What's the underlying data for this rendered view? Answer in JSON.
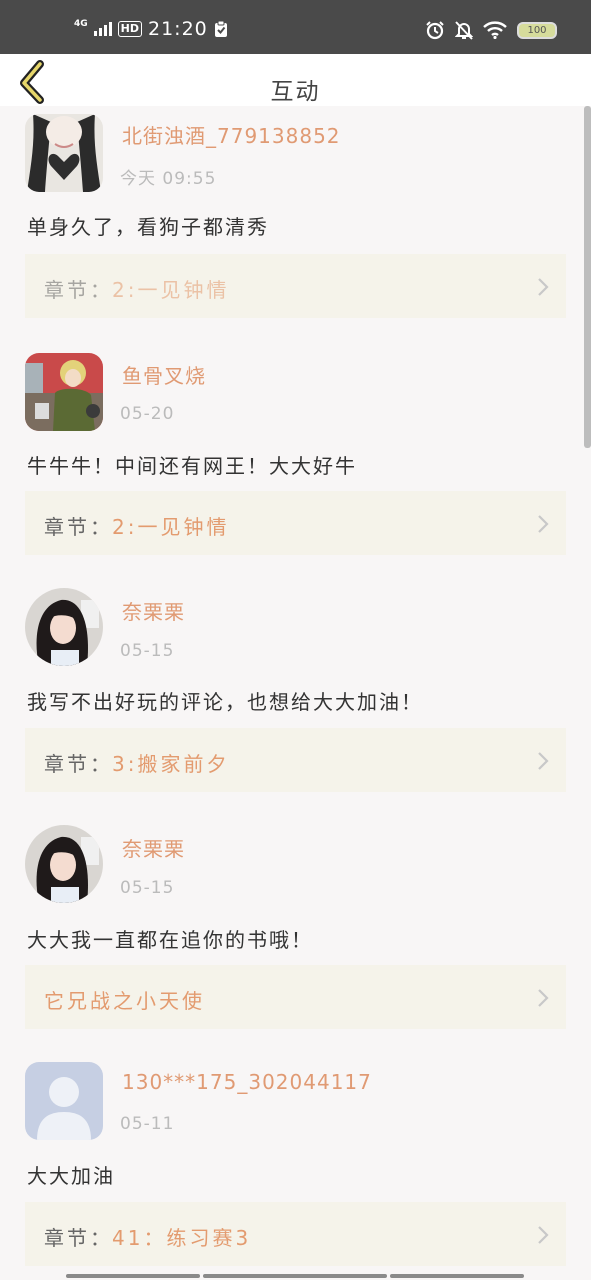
{
  "status_bar": {
    "network": "4G",
    "hd_badge": "HD",
    "time": "21:20",
    "battery": "100"
  },
  "header": {
    "title": "互动"
  },
  "comments": [
    {
      "username": "北街浊酒_779138852",
      "date": "今天 09:55",
      "text": "单身久了，看狗子都清秀",
      "chapter_prefix": "章节：",
      "chapter": "2:一见钟情"
    },
    {
      "username": "鱼骨叉烧",
      "date": "05-20",
      "text": "牛牛牛！中间还有网王！大大好牛",
      "chapter_prefix": "章节：",
      "chapter": "2:一见钟情"
    },
    {
      "username": "奈栗栗",
      "date": "05-15",
      "text": "我写不出好玩的评论，也想给大大加油！",
      "chapter_prefix": "章节：",
      "chapter": "3:搬家前夕"
    },
    {
      "username": "奈栗栗",
      "date": "05-15",
      "text": "大大我一直都在追你的书哦！",
      "chapter_prefix": "",
      "chapter": "它兄战之小天使"
    },
    {
      "username": "130***175_302044117",
      "date": "05-11",
      "text": "大大加油",
      "chapter_prefix": "章节：",
      "chapter": "41：练习赛3"
    }
  ],
  "colors": {
    "accent": "#e09a73",
    "chapter_bg": "#f5f3ea",
    "status_bar": "#4a4a4a"
  }
}
